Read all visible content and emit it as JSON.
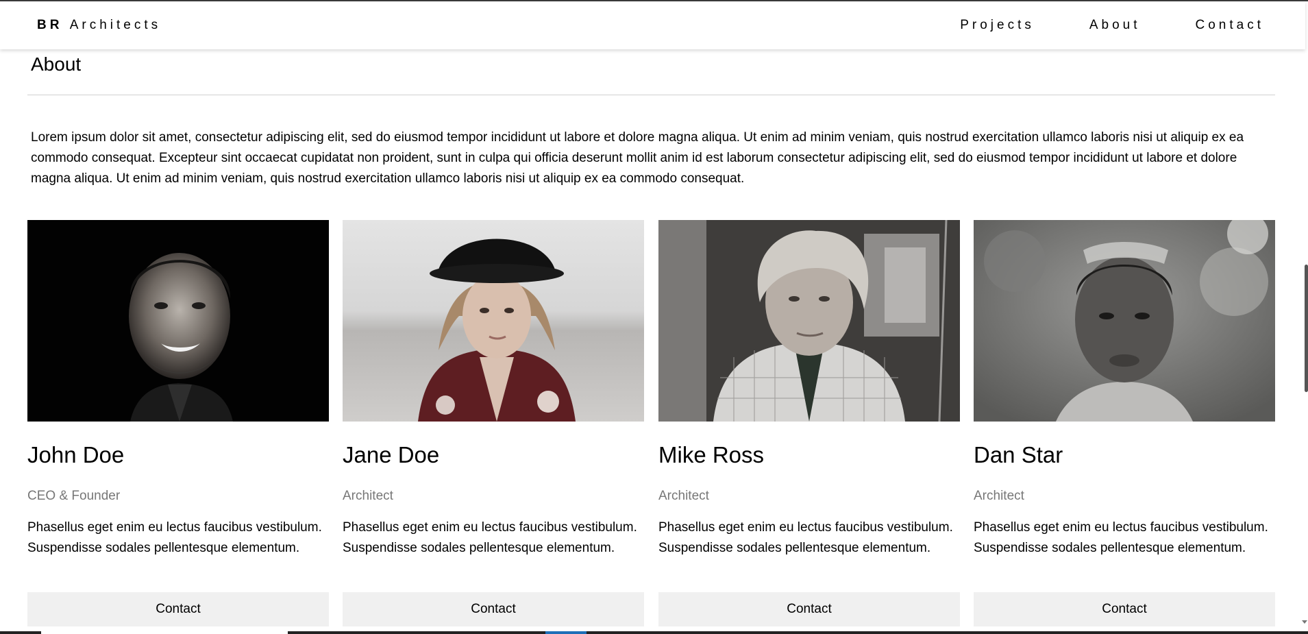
{
  "nav": {
    "brand_bold": "BR",
    "brand_rest": "Architects",
    "links": [
      "Projects",
      "About",
      "Contact"
    ]
  },
  "about": {
    "title": "About",
    "intro": "Lorem ipsum dolor sit amet, consectetur adipiscing elit, sed do eiusmod tempor incididunt ut labore et dolore magna aliqua. Ut enim ad minim veniam, quis nostrud exercitation ullamco laboris nisi ut aliquip ex ea commodo consequat. Excepteur sint occaecat cupidatat non proident, sunt in culpa qui officia deserunt mollit anim id est laborum consectetur adipiscing elit, sed do eiusmod tempor incididunt ut labore et dolore magna aliqua. Ut enim ad minim veniam, quis nostrud exercitation ullamco laboris nisi ut aliquip ex ea commodo consequat."
  },
  "team": [
    {
      "name": "John Doe",
      "role": "CEO & Founder",
      "bio": "Phasellus eget enim eu lectus faucibus vestibulum. Suspendisse sodales pellentesque elementum.",
      "button": "Contact",
      "photo": "portrait-photo-smiling-bearded-man"
    },
    {
      "name": "Jane Doe",
      "role": "Architect",
      "bio": "Phasellus eget enim eu lectus faucibus vestibulum. Suspendisse sodales pellentesque elementum.",
      "button": "Contact",
      "photo": "portrait-photo-woman-black-hat"
    },
    {
      "name": "Mike Ross",
      "role": "Architect",
      "bio": "Phasellus eget enim eu lectus faucibus vestibulum. Suspendisse sodales pellentesque elementum.",
      "button": "Contact",
      "photo": "portrait-photo-older-man-checkered-shirt"
    },
    {
      "name": "Dan Star",
      "role": "Architect",
      "bio": "Phasellus eget enim eu lectus faucibus vestibulum. Suspendisse sodales pellentesque elementum.",
      "button": "Contact",
      "photo": "portrait-photo-young-man-sunglasses-on-head"
    }
  ],
  "colors": {
    "background": "#ffffff",
    "text": "#000000",
    "role_text": "#777777",
    "button_bg": "#f0f0f0",
    "divider": "#d0d0d0"
  }
}
